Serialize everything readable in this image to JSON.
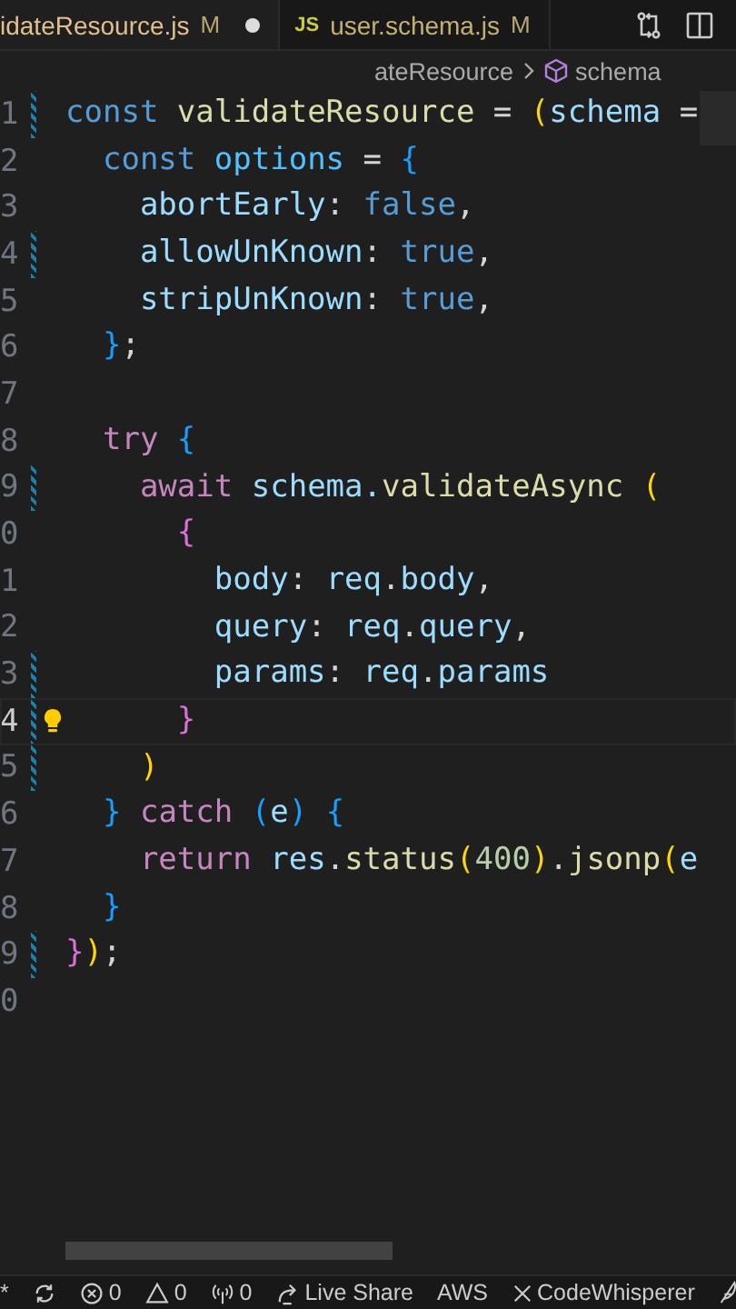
{
  "tabs": [
    {
      "label": "idateResource.js",
      "status": "M",
      "dirty": true,
      "selected": true
    },
    {
      "badge": "JS",
      "label": "user.schema.js",
      "status": "M",
      "dirty": false,
      "selected": false
    }
  ],
  "breadcrumb": [
    {
      "label": "ateResource",
      "kind": "text"
    },
    {
      "label": "schema",
      "kind": "symbol"
    }
  ],
  "lines": [
    {
      "number": "1",
      "current": false,
      "modified": true,
      "lightbulb": false,
      "tokens": [
        {
          "text": "const ",
          "kind": "keyword"
        },
        {
          "text": "validateResource",
          "kind": "function"
        },
        {
          "text": " = ",
          "kind": "plain"
        },
        {
          "text": "(",
          "kind": "bracket1"
        },
        {
          "text": "schema",
          "kind": "variable"
        },
        {
          "text": " =",
          "kind": "plain"
        }
      ]
    },
    {
      "number": "2",
      "current": false,
      "modified": false,
      "lightbulb": false,
      "tokens": [
        {
          "text": "  const ",
          "kind": "keyword"
        },
        {
          "text": "options",
          "kind": "constant"
        },
        {
          "text": " = ",
          "kind": "plain"
        },
        {
          "text": "{",
          "kind": "bracket3"
        }
      ]
    },
    {
      "number": "3",
      "current": false,
      "modified": false,
      "lightbulb": false,
      "tokens": [
        {
          "text": "    abortEarly",
          "kind": "variable"
        },
        {
          "text": ": ",
          "kind": "plain"
        },
        {
          "text": "false",
          "kind": "keyword"
        },
        {
          "text": ",",
          "kind": "plain"
        }
      ]
    },
    {
      "number": "4",
      "current": false,
      "modified": true,
      "lightbulb": false,
      "tokens": [
        {
          "text": "    allowUnKnown",
          "kind": "variable"
        },
        {
          "text": ": ",
          "kind": "plain"
        },
        {
          "text": "true",
          "kind": "keyword"
        },
        {
          "text": ",",
          "kind": "plain"
        }
      ]
    },
    {
      "number": "5",
      "current": false,
      "modified": false,
      "lightbulb": false,
      "tokens": [
        {
          "text": "    stripUnKnown",
          "kind": "variable"
        },
        {
          "text": ": ",
          "kind": "plain"
        },
        {
          "text": "true",
          "kind": "keyword"
        },
        {
          "text": ",",
          "kind": "plain"
        }
      ]
    },
    {
      "number": "6",
      "current": false,
      "modified": false,
      "lightbulb": false,
      "tokens": [
        {
          "text": "  }",
          "kind": "bracket3"
        },
        {
          "text": ";",
          "kind": "plain"
        }
      ]
    },
    {
      "number": "7",
      "current": false,
      "modified": false,
      "lightbulb": false
    },
    {
      "number": "8",
      "current": false,
      "modified": false,
      "lightbulb": false,
      "tokens": [
        {
          "text": "  try ",
          "kind": "control"
        },
        {
          "text": "{",
          "kind": "bracket3"
        }
      ]
    },
    {
      "number": "9",
      "current": false,
      "modified": true,
      "lightbulb": false,
      "tokens": [
        {
          "text": "    await ",
          "kind": "control"
        },
        {
          "text": "schema.",
          "kind": "variable"
        },
        {
          "text": "validateAsync ",
          "kind": "function"
        },
        {
          "text": "(",
          "kind": "bracket1"
        }
      ]
    },
    {
      "number": "0",
      "current": false,
      "modified": false,
      "lightbulb": false,
      "tokens": [
        {
          "text": "      {",
          "kind": "bracket2"
        }
      ]
    },
    {
      "number": "1",
      "current": false,
      "modified": false,
      "lightbulb": false,
      "tokens": [
        {
          "text": "        body",
          "kind": "variable"
        },
        {
          "text": ": ",
          "kind": "plain"
        },
        {
          "text": "req",
          "kind": "variable"
        },
        {
          "text": ".",
          "kind": "plain"
        },
        {
          "text": "body",
          "kind": "variable"
        },
        {
          "text": ",",
          "kind": "plain"
        }
      ]
    },
    {
      "number": "2",
      "current": false,
      "modified": false,
      "lightbulb": false,
      "tokens": [
        {
          "text": "        query",
          "kind": "variable"
        },
        {
          "text": ": ",
          "kind": "plain"
        },
        {
          "text": "req",
          "kind": "variable"
        },
        {
          "text": ".",
          "kind": "plain"
        },
        {
          "text": "query",
          "kind": "variable"
        },
        {
          "text": ",",
          "kind": "plain"
        }
      ]
    },
    {
      "number": "3",
      "current": false,
      "modified": true,
      "lightbulb": false,
      "tokens": [
        {
          "text": "        params",
          "kind": "variable"
        },
        {
          "text": ": ",
          "kind": "plain"
        },
        {
          "text": "req",
          "kind": "variable"
        },
        {
          "text": ".",
          "kind": "plain"
        },
        {
          "text": "params",
          "kind": "variable"
        }
      ]
    },
    {
      "number": "4",
      "current": true,
      "modified": true,
      "lightbulb": true,
      "tokens": [
        {
          "text": "      }",
          "kind": "bracket2"
        }
      ]
    },
    {
      "number": "5",
      "current": false,
      "modified": true,
      "lightbulb": false,
      "tokens": [
        {
          "text": "    )",
          "kind": "bracket1"
        }
      ]
    },
    {
      "number": "6",
      "current": false,
      "modified": false,
      "lightbulb": false,
      "tokens": [
        {
          "text": "  } ",
          "kind": "bracket3"
        },
        {
          "text": "catch ",
          "kind": "control"
        },
        {
          "text": "(",
          "kind": "bracket3"
        },
        {
          "text": "e",
          "kind": "variable"
        },
        {
          "text": ") {",
          "kind": "bracket3"
        }
      ]
    },
    {
      "number": "7",
      "current": false,
      "modified": false,
      "lightbulb": false,
      "tokens": [
        {
          "text": "    return ",
          "kind": "control"
        },
        {
          "text": "res",
          "kind": "variable"
        },
        {
          "text": ".",
          "kind": "plain"
        },
        {
          "text": "status",
          "kind": "function"
        },
        {
          "text": "(",
          "kind": "bracket1"
        },
        {
          "text": "400",
          "kind": "number"
        },
        {
          "text": ")",
          "kind": "bracket1"
        },
        {
          "text": ".",
          "kind": "plain"
        },
        {
          "text": "jsonp",
          "kind": "function"
        },
        {
          "text": "(",
          "kind": "bracket1"
        },
        {
          "text": "e",
          "kind": "variable"
        }
      ]
    },
    {
      "number": "8",
      "current": false,
      "modified": false,
      "lightbulb": false,
      "tokens": [
        {
          "text": "  }",
          "kind": "bracket3"
        }
      ]
    },
    {
      "number": "9",
      "current": false,
      "modified": true,
      "lightbulb": false,
      "tokens": [
        {
          "text": "}",
          "kind": "bracket2"
        },
        {
          "text": ")",
          "kind": "bracket1"
        },
        {
          "text": ";",
          "kind": "plain"
        }
      ]
    },
    {
      "number": "0",
      "current": false,
      "modified": false,
      "lightbulb": false
    }
  ],
  "status_bar": [
    {
      "kind": "remote",
      "text": "*"
    },
    {
      "kind": "sync"
    },
    {
      "kind": "errors",
      "text": "0"
    },
    {
      "kind": "warnings",
      "text": "0"
    },
    {
      "kind": "ports",
      "text": "0"
    },
    {
      "kind": "live_share",
      "text": "Live Share"
    },
    {
      "kind": "plain",
      "text": "AWS"
    },
    {
      "kind": "codewhisperer",
      "text": "CodeWhisperer"
    },
    {
      "kind": "feedback"
    }
  ]
}
